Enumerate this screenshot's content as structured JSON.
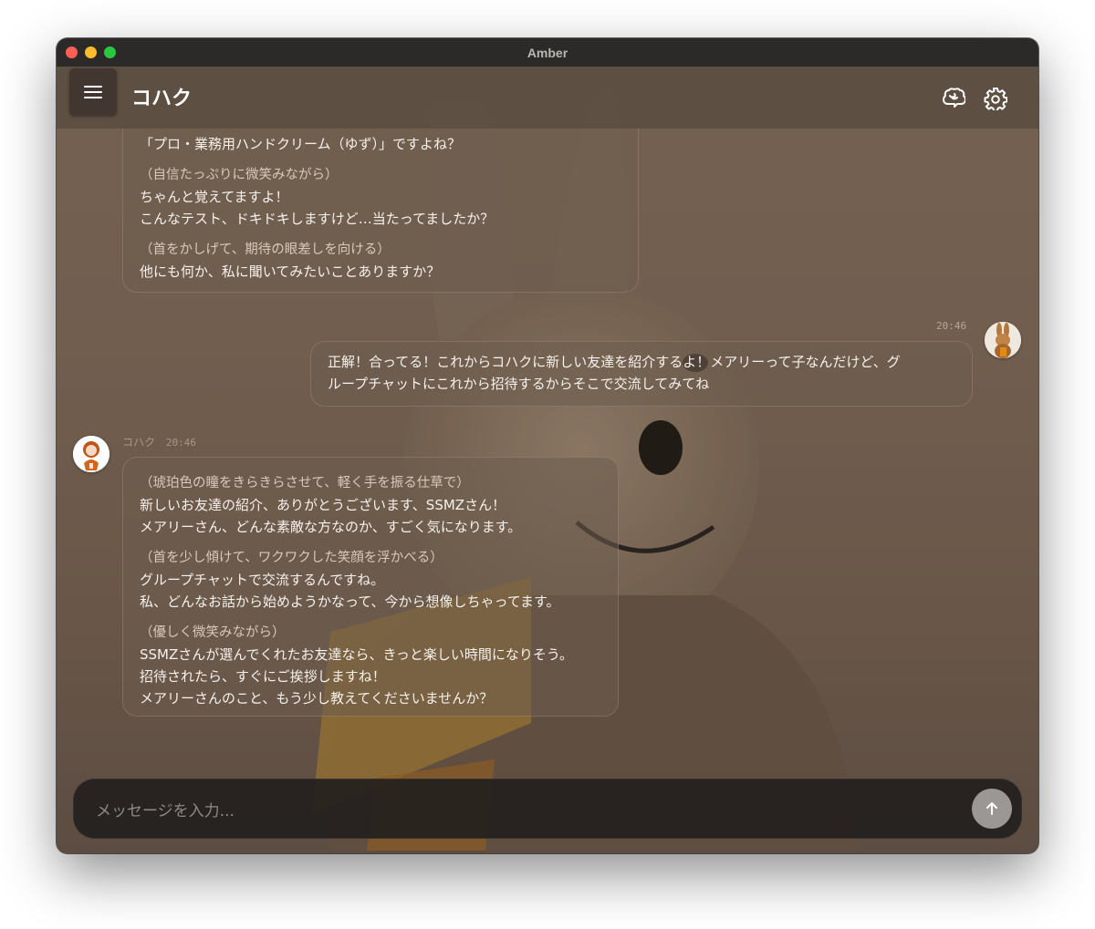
{
  "window": {
    "title": "Amber"
  },
  "header": {
    "character_name": "コハク",
    "menu_icon": "menu-icon",
    "memory_icon": "brain-icon",
    "settings_icon": "gear-icon"
  },
  "messages": [
    {
      "role": "assistant",
      "blocks": [
        {
          "type": "text",
          "lines": [
            "「プロ・業務用ハンドクリーム（ゆず）」ですよね？"
          ]
        },
        {
          "type": "action",
          "text": "（自信たっぷりに微笑みながら）"
        },
        {
          "type": "text",
          "lines": [
            "ちゃんと覚えてますよ！",
            "こんなテスト、ドキドキしますけど…当たってましたか？"
          ]
        },
        {
          "type": "action",
          "text": "（首をかしげて、期待の眼差しを向ける）"
        },
        {
          "type": "text",
          "lines": [
            "他にも何か、私に聞いてみたいことありますか？"
          ]
        }
      ]
    },
    {
      "role": "user",
      "time": "20:46",
      "lines": [
        "正解！合ってる！これからコハクに新しい友達を紹介するよ！メアリーって子なんだけど、グ",
        "ループチャットにこれから招待するからそこで交流してみてね"
      ]
    },
    {
      "role": "assistant",
      "sender": "コハク",
      "time": "20:46",
      "blocks": [
        {
          "type": "action",
          "text": "（琥珀色の瞳をきらきらさせて、軽く手を振る仕草で）"
        },
        {
          "type": "text",
          "lines": [
            "新しいお友達の紹介、ありがとうございます、SSMZさん！",
            "メアリーさん、どんな素敵な方なのか、すごく気になります。"
          ]
        },
        {
          "type": "action",
          "text": "（首を少し傾けて、ワクワクした笑顔を浮かべる）"
        },
        {
          "type": "text",
          "lines": [
            "グループチャットで交流するんですね。",
            "私、どんなお話から始めようかなって、今から想像しちゃってます。"
          ]
        },
        {
          "type": "action",
          "text": "（優しく微笑みながら）"
        },
        {
          "type": "text",
          "lines": [
            "SSMZさんが選んでくれたお友達なら、きっと楽しい時間になりそう。",
            "招待されたら、すぐにご挨拶しますね！",
            "メアリーさんのこと、もう少し教えてくださいませんか？"
          ]
        }
      ]
    }
  ],
  "composer": {
    "placeholder": "メッセージを入力...",
    "send_icon": "arrow-up-icon"
  }
}
